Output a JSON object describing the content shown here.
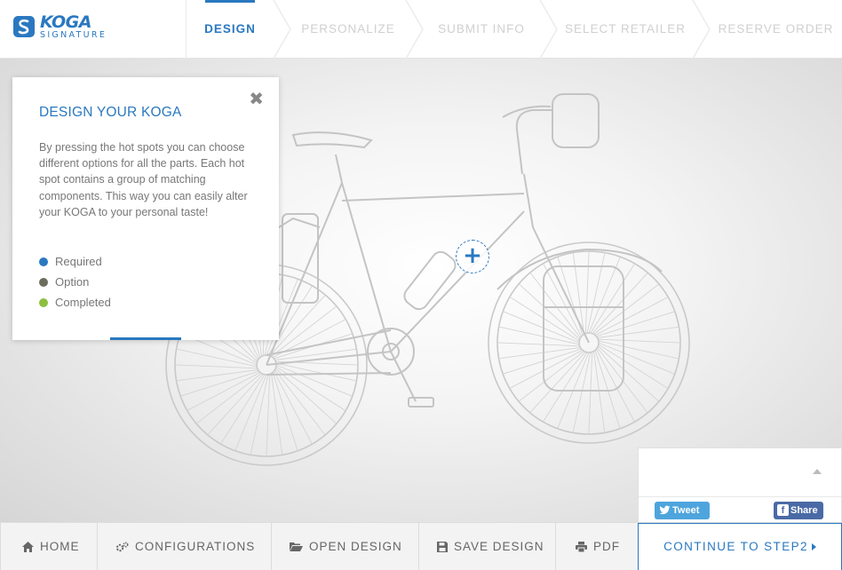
{
  "brand": {
    "name": "KOGA",
    "tagline": "SIGNATURE",
    "color": "#2a78c0"
  },
  "steps": [
    {
      "label": "DESIGN",
      "active": true
    },
    {
      "label": "PERSONALIZE",
      "active": false
    },
    {
      "label": "SUBMIT INFO",
      "active": false
    },
    {
      "label": "SELECT RETAILER",
      "active": false
    },
    {
      "label": "RESERVE ORDER",
      "active": false
    }
  ],
  "info": {
    "title": "DESIGN YOUR KOGA",
    "text": "By pressing the hot spots you can choose different options for all the parts. Each hot spot contains a group of matching components. This way you can easily alter your KOGA to your personal taste!",
    "close_glyph": "✖",
    "legend": [
      {
        "label": "Required",
        "color": "#2a78c0"
      },
      {
        "label": "Option",
        "color": "#6e6e60"
      },
      {
        "label": "Completed",
        "color": "#8cbf3f"
      }
    ]
  },
  "hotspot": {
    "glyph": "+"
  },
  "share": {
    "tweet": "Tweet",
    "facebook": "Share",
    "facebook_glyph": "f"
  },
  "toolbar": {
    "home": "HOME",
    "configurations": "CONFIGURATIONS",
    "open_design": "OPEN DESIGN",
    "save_design": "SAVE DESIGN",
    "pdf": "PDF",
    "continue": "CONTINUE TO STEP2"
  }
}
